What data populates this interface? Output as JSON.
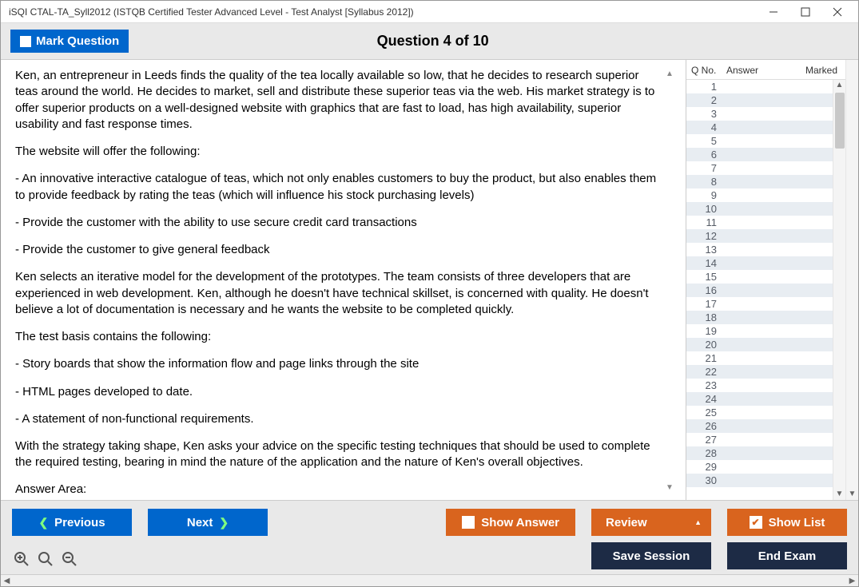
{
  "window": {
    "title": "iSQI CTAL-TA_Syll2012 (ISTQB Certified Tester Advanced Level - Test Analyst [Syllabus 2012])"
  },
  "topbar": {
    "mark_question": "Mark Question",
    "question_title": "Question 4 of 10"
  },
  "question": {
    "p1": "Ken, an entrepreneur in Leeds finds the quality of the tea locally available so low, that he decides to research superior teas around the world. He decides to market, sell and distribute these superior teas via the web. His market strategy is to offer superior products on a well-designed website with graphics that are fast to load, has high availability, superior usability and fast response times.",
    "p2": "The website will offer the following:",
    "p3": "- An innovative interactive catalogue of teas, which not only enables customers to buy the product, but also enables them to provide feedback by rating the teas (which will influence his stock purchasing levels)",
    "p4": "- Provide the customer with the ability to use secure credit card transactions",
    "p5": "- Provide the customer to give general feedback",
    "p6": "Ken selects an iterative model for the development of the prototypes. The team consists of three developers that are experienced in web development. Ken, although he doesn't have technical skillset, is concerned with quality. He doesn't believe a lot of documentation is necessary and he wants the website to be completed quickly.",
    "p7": "The test basis contains the following:",
    "p8": "- Story boards that show the information flow and page links through the site",
    "p9": "- HTML pages developed to date.",
    "p10": "- A statement of non-functional requirements.",
    "p11": "With the strategy taking shape, Ken asks your advice on the specific testing techniques that should be used to complete the required testing, bearing in mind the nature of the application and the nature of Ken's overall objectives.",
    "answer_label": "Answer Area:"
  },
  "side": {
    "h1": "Q No.",
    "h2": "Answer",
    "h3": "Marked",
    "rows": [
      "1",
      "2",
      "3",
      "4",
      "5",
      "6",
      "7",
      "8",
      "9",
      "10",
      "11",
      "12",
      "13",
      "14",
      "15",
      "16",
      "17",
      "18",
      "19",
      "20",
      "21",
      "22",
      "23",
      "24",
      "25",
      "26",
      "27",
      "28",
      "29",
      "30"
    ]
  },
  "buttons": {
    "previous": "Previous",
    "next": "Next",
    "show_answer": "Show Answer",
    "review": "Review",
    "show_list": "Show List",
    "save_session": "Save Session",
    "end_exam": "End Exam"
  }
}
